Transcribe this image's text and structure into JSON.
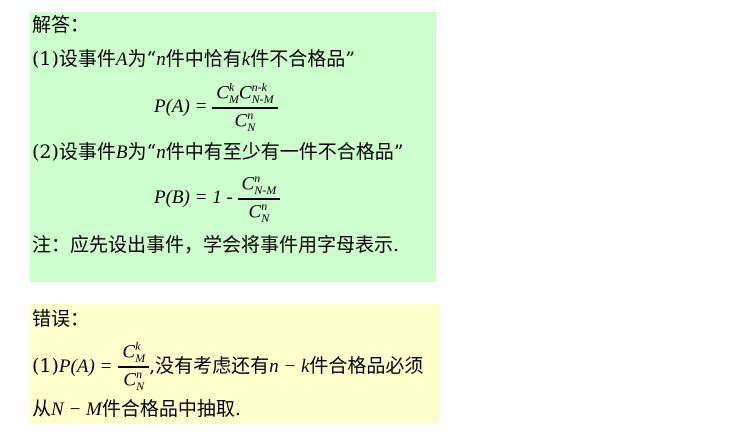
{
  "answer": {
    "heading": "解答：",
    "part1_label": "(1)设事件",
    "part1_event": "A",
    "part1_text": "为“",
    "part1_n": "n",
    "part1_mid": "件中恰有",
    "part1_k": "k",
    "part1_end": "件不合格品”",
    "formula1_lhs": "P(A) =",
    "formula1_num_sup1": "k",
    "formula1_num_sub1": "M",
    "formula1_num_sup2": "n-k",
    "formula1_num_sub2": "N-M",
    "formula1_den_sup": "n",
    "formula1_den_sub": "N",
    "part2_label": "(2)设事件",
    "part2_event": "B",
    "part2_text": "为“",
    "part2_n": "n",
    "part2_end": "件中有至少有一件不合格品”",
    "formula2_lhs": "P(B) = 1 -",
    "formula2_num_sup": "n",
    "formula2_num_sub": "N-M",
    "formula2_den_sup": "n",
    "formula2_den_sub": "N",
    "note": "注：应先设出事件，学会将事件用字母表示."
  },
  "error": {
    "heading": "错误：",
    "line1_label": "(1)",
    "formula_lhs": "P(A) =",
    "formula_num_sup": "k",
    "formula_num_sub": "M",
    "formula_den_sup": "n",
    "formula_den_sub": "N",
    "line1_text": ",没有考虑还有",
    "line1_expr": "n − k",
    "line1_end": "件合格品必须",
    "line2_start": "从",
    "line2_expr": "N − M",
    "line2_end": "件合格品中抽取."
  },
  "colors": {
    "answer_bg": "#ccffcc",
    "error_bg": "#ffffcc"
  }
}
